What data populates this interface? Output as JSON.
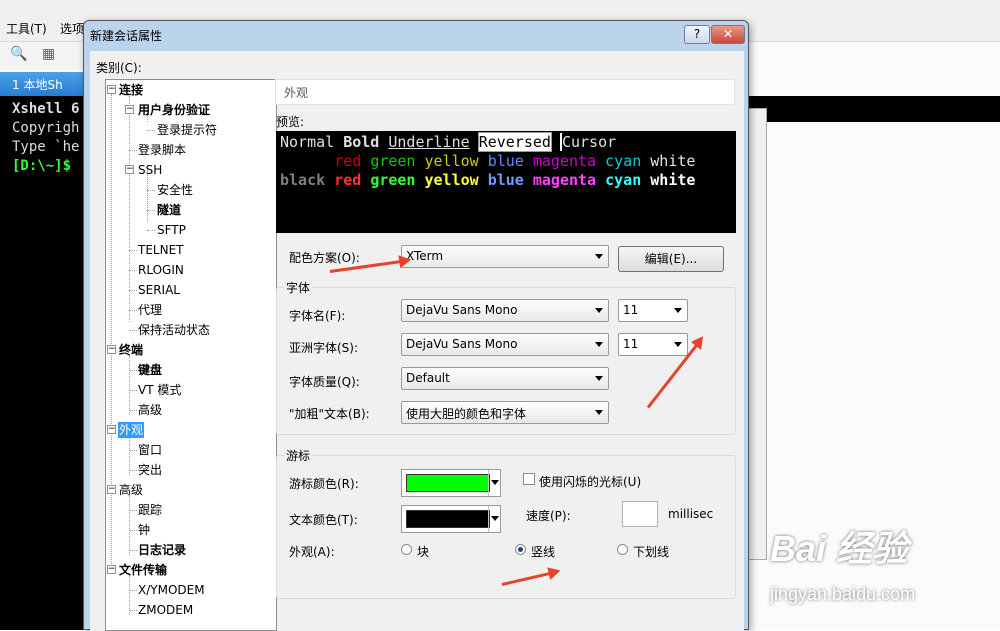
{
  "background": {
    "menu": [
      "工具(T)",
      "选项"
    ],
    "tab_label": "1 本地Sh",
    "terminal_lines": [
      "Xshell 6",
      "Copyrigh",
      "",
      "Type `he",
      "[D:\\~]$"
    ]
  },
  "dialog": {
    "title": "新建会话属性",
    "help_label": "?",
    "close_label": "✕",
    "category_label": "类别(C):",
    "tree": [
      {
        "label": "连接",
        "bold": true
      },
      {
        "label": "用户身份验证",
        "bold": true
      },
      {
        "label": "登录提示符",
        "bold": false
      },
      {
        "label": "登录脚本",
        "bold": false
      },
      {
        "label": "SSH",
        "bold": false
      },
      {
        "label": "安全性",
        "bold": false
      },
      {
        "label": "隧道",
        "bold": true
      },
      {
        "label": "SFTP",
        "bold": false
      },
      {
        "label": "TELNET",
        "bold": false
      },
      {
        "label": "RLOGIN",
        "bold": false
      },
      {
        "label": "SERIAL",
        "bold": false
      },
      {
        "label": "代理",
        "bold": false
      },
      {
        "label": "保持活动状态",
        "bold": false
      },
      {
        "label": "终端",
        "bold": true
      },
      {
        "label": "键盘",
        "bold": true
      },
      {
        "label": "VT 模式",
        "bold": false
      },
      {
        "label": "高级",
        "bold": false
      },
      {
        "label": "外观",
        "bold": false,
        "selected": true
      },
      {
        "label": "窗口",
        "bold": false
      },
      {
        "label": "突出",
        "bold": false
      },
      {
        "label": "高级",
        "bold": false
      },
      {
        "label": "跟踪",
        "bold": false
      },
      {
        "label": "钟",
        "bold": false
      },
      {
        "label": "日志记录",
        "bold": true
      },
      {
        "label": "文件传输",
        "bold": true
      },
      {
        "label": "X/YMODEM",
        "bold": false
      },
      {
        "label": "ZMODEM",
        "bold": false
      }
    ],
    "section_title": "外观",
    "preview_label": "预览:",
    "preview": {
      "line1": [
        "Normal",
        "Bold",
        "Underline",
        "Reversed",
        "Cursor"
      ],
      "colors": [
        "red",
        "green",
        "yellow",
        "blue",
        "magenta",
        "cyan",
        "white"
      ],
      "black": "black",
      "palette_dim": {
        "red": "#cd0000",
        "green": "#00cd00",
        "yellow": "#cdcd00",
        "blue": "#5c8cff",
        "magenta": "#cd00cd",
        "cyan": "#00cdcd",
        "white": "#e5e5e5",
        "black": "#7f7f7f"
      },
      "palette_bright": {
        "red": "#ff3030",
        "green": "#33ff33",
        "yellow": "#ffff33",
        "blue": "#6f9bff",
        "magenta": "#ff44ff",
        "cyan": "#33ffff",
        "white": "#ffffff"
      }
    },
    "color_scheme": {
      "label": "配色方案(O):",
      "value": "XTerm",
      "edit_button": "编辑(E)..."
    },
    "font_group": {
      "title": "字体",
      "font_name_label": "字体名(F):",
      "font_name_value": "DejaVu Sans Mono",
      "font_size_value": "11",
      "asian_font_label": "亚洲字体(S):",
      "asian_font_value": "DejaVu Sans Mono",
      "asian_size_value": "11",
      "quality_label": "字体质量(Q):",
      "quality_value": "Default",
      "bold_label": "\"加粗\"文本(B):",
      "bold_value": "使用大胆的颜色和字体"
    },
    "cursor_group": {
      "title": "游标",
      "cursor_color_label": "游标颜色(R):",
      "cursor_color": "#00ff00",
      "text_color_label": "文本颜色(T):",
      "text_color": "#000000",
      "blink_label": "使用闪烁的光标(U)",
      "speed_label": "速度(P):",
      "speed_unit": "millisec",
      "appearance_label": "外观(A):",
      "shape_block": "块",
      "shape_vline": "竖线",
      "shape_underline": "下划线",
      "selected_shape": "竖线"
    }
  },
  "watermark": {
    "logo": "Bai 经验",
    "url": "jingyan.baidu.com"
  }
}
